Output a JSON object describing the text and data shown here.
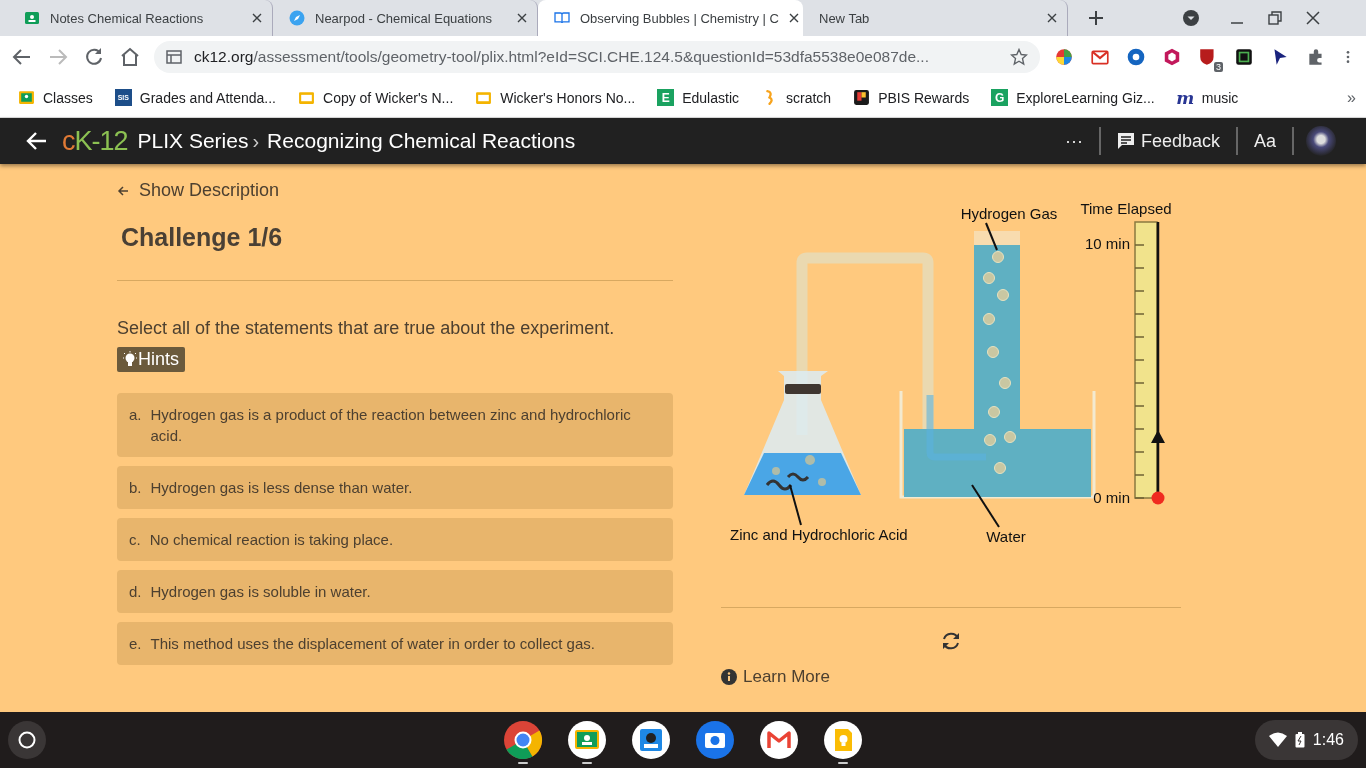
{
  "browser": {
    "tabs": [
      {
        "title": "Notes Chemical Reactions",
        "kind": "classroom",
        "selected": false
      },
      {
        "title": "Nearpod - Chemical Equations",
        "kind": "nearpod",
        "selected": false
      },
      {
        "title": "Observing Bubbles | Chemistry | C",
        "kind": "book",
        "selected": true
      },
      {
        "title": "New Tab",
        "kind": "blank",
        "selected": false
      }
    ],
    "url": {
      "host": "ck12.org",
      "path": "/assessment/tools/geometry-tool/plix.html?eId=SCI.CHE.124.5&questionId=53dfa5538e0e087de..."
    },
    "extensions": [
      {
        "kind": "wheel"
      },
      {
        "kind": "mail"
      },
      {
        "kind": "disc"
      },
      {
        "kind": "hexagon"
      },
      {
        "kind": "shield",
        "badge": "3"
      },
      {
        "kind": "square"
      },
      {
        "kind": "cursor"
      },
      {
        "kind": "puzzle"
      }
    ],
    "bookmarks": [
      {
        "label": "Classes",
        "kind": "classroom"
      },
      {
        "label": "Grades and Attenda...",
        "kind": "letters",
        "icon_text": "SIS"
      },
      {
        "label": "Copy of Wicker's N...",
        "kind": "slides"
      },
      {
        "label": "Wicker's Honors No...",
        "kind": "slides"
      },
      {
        "label": "Edulastic",
        "kind": "letter",
        "icon_text": "E"
      },
      {
        "label": "scratch",
        "kind": "scratch"
      },
      {
        "label": "PBIS Rewards",
        "kind": "pbis"
      },
      {
        "label": "ExploreLearning Giz...",
        "kind": "letter",
        "icon_text": "G"
      },
      {
        "label": "music",
        "kind": "italic",
        "icon_text": "m"
      }
    ],
    "more": "»"
  },
  "header": {
    "logo": [
      {
        "text": "c",
        "color": "#e07a35"
      },
      {
        "text": "K-12",
        "color": "#8cc152"
      }
    ],
    "breadcrumb": [
      {
        "text": "PLIX Series"
      },
      {
        "text": "›"
      },
      {
        "text": "Recognizing Chemical Reactions"
      }
    ],
    "more": "···",
    "feedback": "Feedback",
    "font_button": "Aa"
  },
  "question": {
    "show_description": "Show Description",
    "challenge": "Challenge 1/6",
    "prompt": "Select all of the statements that are true about the experiment.",
    "hints": "Hints",
    "options": [
      {
        "letter": "a.",
        "text": "Hydrogen gas is a product of the reaction between zinc and hydrochloric acid."
      },
      {
        "letter": "b.",
        "text": "Hydrogen gas is less dense than water."
      },
      {
        "letter": "c.",
        "text": "No chemical reaction is taking place."
      },
      {
        "letter": "d.",
        "text": "Hydrogen gas is soluble in water."
      },
      {
        "letter": "e.",
        "text": "This method uses the displacement of water in order to collect gas."
      }
    ]
  },
  "experiment": {
    "labels": {
      "gas": "Hydrogen Gas",
      "flask": "Zinc and Hydrochloric Acid",
      "water": "Water"
    },
    "timer": {
      "title": "Time Elapsed",
      "max_label": "10 min",
      "min_label": "0 min"
    },
    "learn_more": "Learn More"
  },
  "taskbar": {
    "apps": [
      {
        "kind": "chrome",
        "running": true
      },
      {
        "kind": "classroom",
        "running": true
      },
      {
        "kind": "game",
        "running": false
      },
      {
        "kind": "camera",
        "running": false
      },
      {
        "kind": "gmail",
        "running": false
      },
      {
        "kind": "keep",
        "running": true
      }
    ],
    "time": "1:46"
  }
}
